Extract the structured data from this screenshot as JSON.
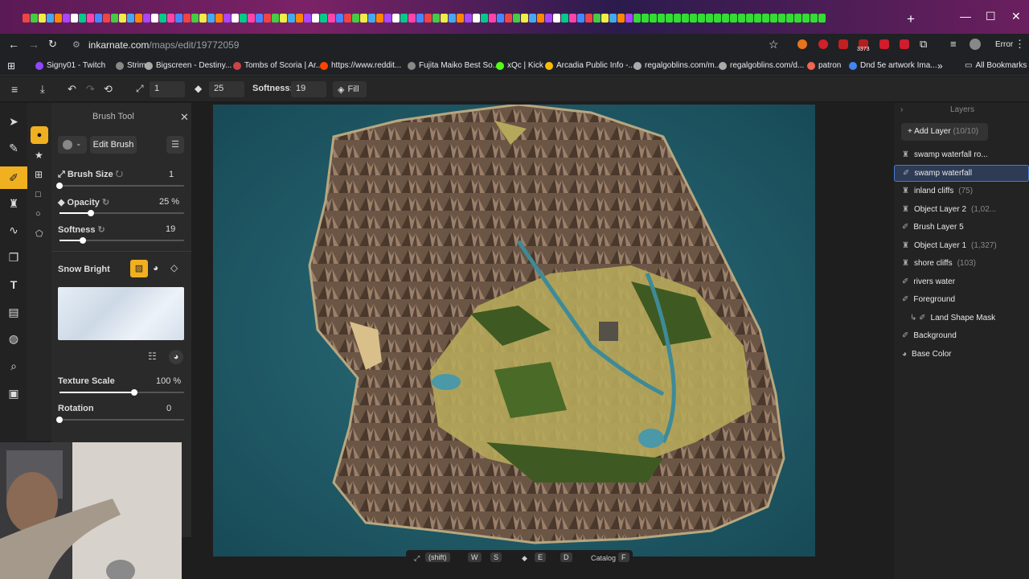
{
  "browser": {
    "url_domain": "inkarnate.com",
    "url_path": "/maps/edit/19772059",
    "error_label": "Error",
    "bookmarks": [
      {
        "label": "Signy01 - Twitch"
      },
      {
        "label": "Strims"
      },
      {
        "label": "Bigscreen - Destiny..."
      },
      {
        "label": "Tombs of Scoria | Ar..."
      },
      {
        "label": "https://www.reddit..."
      },
      {
        "label": "Fujita Maiko Best So..."
      },
      {
        "label": "xQc | Kick"
      },
      {
        "label": "Arcadia Public Info -..."
      },
      {
        "label": "regalgoblins.com/m..."
      },
      {
        "label": "regalgoblins.com/d..."
      },
      {
        "label": "patron"
      },
      {
        "label": "Dnd 5e artwork Ima..."
      }
    ],
    "all_bookmarks": "All Bookmarks",
    "extension_badge": "3373"
  },
  "toolbar": {
    "size_value": "1",
    "opacity_value": "25",
    "softness_label": "Softness:",
    "softness_value": "19",
    "fill_label": "Fill"
  },
  "brush_panel": {
    "title": "Brush Tool",
    "edit_brush": "Edit Brush",
    "brush_size_label": "Brush Size",
    "brush_size_value": "1",
    "brush_size_level": 0.0,
    "opacity_label": "Opacity",
    "opacity_value": "25 %",
    "opacity_level": 0.25,
    "softness_label": "Softness",
    "softness_value": "19",
    "softness_level": 0.19,
    "texture_name": "Snow Bright",
    "texture_scale_label": "Texture Scale",
    "texture_scale_value": "100 %",
    "texture_scale_level": 0.6,
    "rotation_label": "Rotation",
    "rotation_value": "0",
    "rotation_level": 0.0
  },
  "layers_panel": {
    "title": "Layers",
    "add_layer": "Add Layer",
    "layer_count": "(10/10)",
    "layers": [
      {
        "name": "swamp waterfall ro...",
        "count": "",
        "icon": "object-icon",
        "selected": false
      },
      {
        "name": "swamp waterfall",
        "count": "",
        "icon": "brush-icon",
        "selected": true
      },
      {
        "name": "inland cliffs",
        "count": "(75)",
        "icon": "object-icon",
        "selected": false
      },
      {
        "name": "Object Layer 2",
        "count": "(1,02...",
        "icon": "object-icon",
        "selected": false
      },
      {
        "name": "Brush Layer 5",
        "count": "",
        "icon": "brush-icon",
        "selected": false
      },
      {
        "name": "Object Layer 1",
        "count": "(1,327)",
        "icon": "object-icon",
        "selected": false
      },
      {
        "name": "shore cliffs",
        "count": "(103)",
        "icon": "object-icon",
        "selected": false
      },
      {
        "name": "rivers water",
        "count": "",
        "icon": "brush-icon",
        "selected": false
      },
      {
        "name": "Foreground",
        "count": "",
        "icon": "brush-icon",
        "selected": false
      },
      {
        "name": "Land Shape Mask",
        "count": "",
        "icon": "mask-icon",
        "selected": false
      },
      {
        "name": "Background",
        "count": "",
        "icon": "brush-icon",
        "selected": false
      },
      {
        "name": "Base Color",
        "count": "",
        "icon": "palette-icon",
        "selected": false
      }
    ]
  },
  "bottom_bar": {
    "shift_key": "(shift)",
    "key_w": "W",
    "key_s": "S",
    "key_e": "E",
    "key_d": "D",
    "catalog_label": "Catalog",
    "key_f": "F"
  }
}
